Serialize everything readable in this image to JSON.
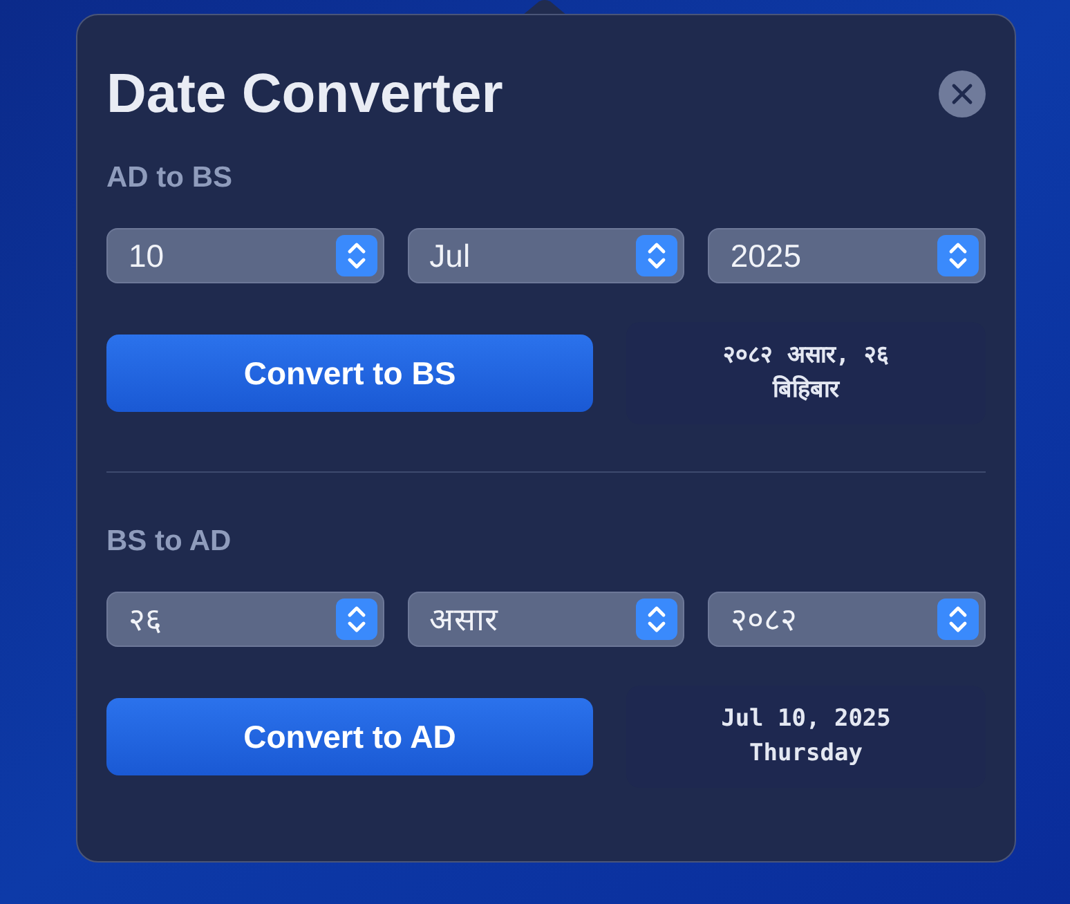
{
  "window": {
    "title": "Date Converter"
  },
  "sections": [
    {
      "heading": "AD to BS",
      "selects": [
        {
          "value": "10"
        },
        {
          "value": "Jul"
        },
        {
          "value": "2025"
        }
      ],
      "button": "Convert to BS",
      "result": [
        "२०८२ असार, २६",
        "बिहिबार"
      ]
    },
    {
      "heading": "BS to AD",
      "selects": [
        {
          "value": "२६"
        },
        {
          "value": "असार"
        },
        {
          "value": "२०८२"
        }
      ],
      "button": "Convert to AD",
      "result": [
        "Jul 10, 2025",
        "Thursday"
      ]
    }
  ]
}
